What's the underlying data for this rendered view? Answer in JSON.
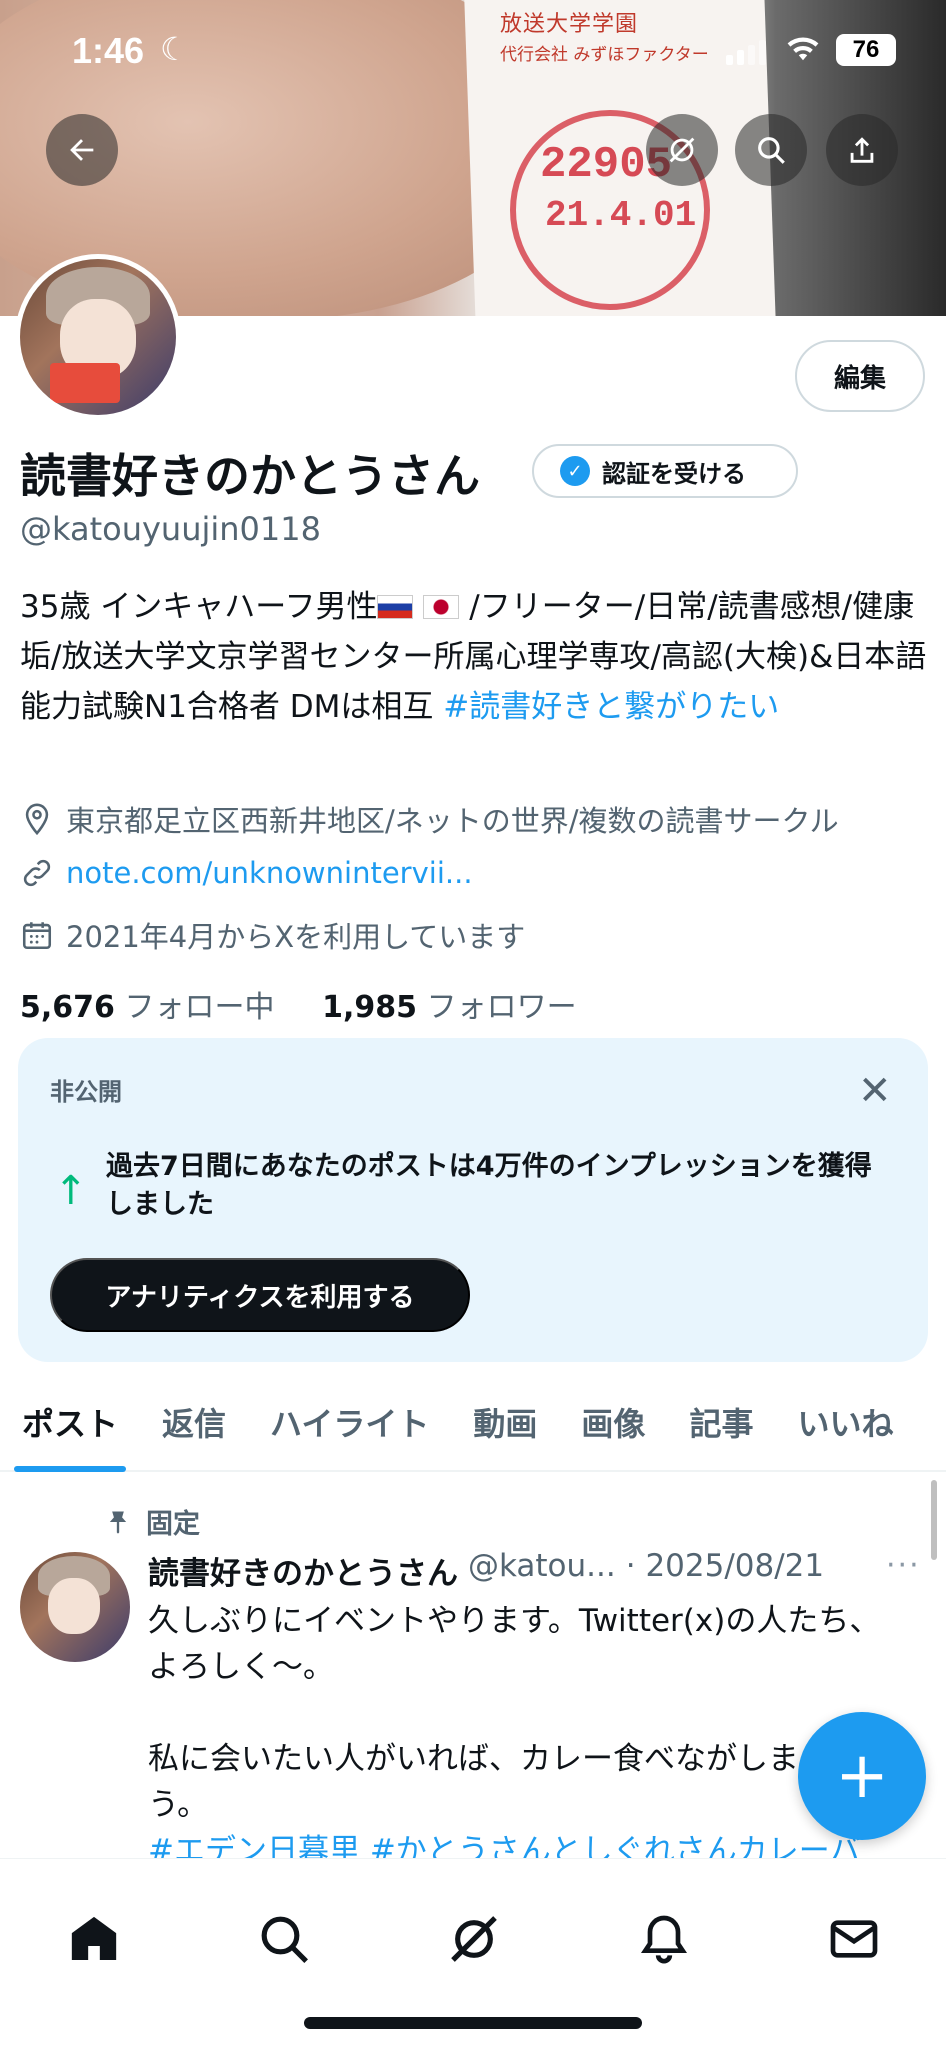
{
  "status_bar": {
    "time": "1:46",
    "battery": "76"
  },
  "profile": {
    "display_name": "読書好きのかとうさん",
    "verify_button": "認証を受ける",
    "handle": "@katouyuujin0118",
    "edit_button": "編集",
    "bio_part1": "35歳 インキャハーフ男性",
    "bio_part2": " /フリーター/日常/読書感想/健康垢/放送大学文京学習センター所属心理学専攻/高認(大検)&日本語能力試験N1合格者 DMは相互 ",
    "bio_hashtag": "#読書好きと繋がりたい",
    "location": "東京都足立区西新井地区/ネットの世界/複数の読書サークル",
    "link": "note.com/unknownintervii...",
    "joined": "2021年4月からXを利用しています",
    "following_count": "5,676",
    "following_label": "フォロー中",
    "followers_count": "1,985",
    "followers_label": "フォロワー"
  },
  "analytics_card": {
    "label": "非公開",
    "message": "過去7日間にあなたのポストは4万件のインプレッションを獲得しました",
    "cta": "アナリティクスを利用する"
  },
  "tabs": [
    "ポスト",
    "返信",
    "ハイライト",
    "動画",
    "画像",
    "記事",
    "いいね"
  ],
  "pinned_post": {
    "pinned_label": "固定",
    "author": "読書好きのかとうさん",
    "handle": "@katou...",
    "date": "· 2025/08/21",
    "more": "···",
    "body": "久しぶりにイベントやります。Twitter(x)の人たち、よろしく〜。\n\n私に会いたい人がいれば、カレー食べながしましょう。",
    "tags": "#エデン日暮里 #かとうさんとしぐれさんカレーバ"
  },
  "banner": {
    "paper_line1": "放送大学学園",
    "paper_line2": "代行会社 みずほファクター",
    "stamp_number": "22905",
    "stamp_date": "21.4.01"
  },
  "icons": {
    "back": "back-arrow-icon",
    "grok": "grok-icon",
    "search": "search-icon",
    "share": "share-icon",
    "location": "location-pin-icon",
    "link": "link-icon",
    "calendar": "calendar-icon",
    "close": "close-icon",
    "up_arrow": "up-arrow-icon",
    "pin": "pin-icon",
    "compose": "plus-icon",
    "home": "home-icon",
    "explore": "search-icon",
    "grok_nav": "grok-icon",
    "notifications": "bell-icon",
    "messages": "mail-icon"
  },
  "colors": {
    "accent": "#1d9bf0",
    "text": "#0f1419",
    "secondary": "#536471",
    "card_bg": "#e8f5fd",
    "positive": "#00ba7c"
  }
}
